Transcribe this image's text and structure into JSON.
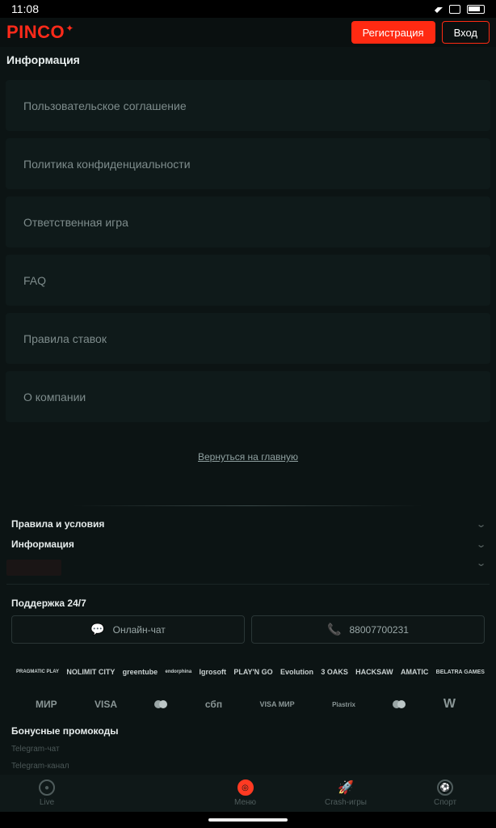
{
  "status": {
    "time": "11:08"
  },
  "header": {
    "logo": "PINCO",
    "register": "Регистрация",
    "login": "Вход"
  },
  "info": {
    "title": "Информация",
    "items": [
      "Пользовательское соглашение",
      "Политика конфиденциальности",
      "Ответственная игра",
      "FAQ",
      "Правила ставок",
      "О компании"
    ]
  },
  "back_link": "Вернуться на главную",
  "footer": {
    "accordion": [
      "Правила и условия",
      "Информация"
    ],
    "support": {
      "title": "Поддержка 24/7",
      "chat": "Онлайн-чат",
      "phone": "88007700231"
    },
    "providers": [
      "PRAGMATIC PLAY",
      "NOLIMIT CITY",
      "greentube",
      "endorphina",
      "Igrosoft",
      "PLAY'N GO",
      "Evolution",
      "3 OAKS",
      "HACKSAW",
      "AMATIC",
      "BELATRA GAMES"
    ],
    "payments": [
      "МИР",
      "VISA",
      "mastercard",
      "сбп",
      "VISA МИР",
      "Piastrix",
      "maestro",
      "W"
    ],
    "bonus_title": "Бонусные промокоды",
    "links": [
      "Telegram-чат",
      "Telegram-канал"
    ]
  },
  "nav": {
    "live": "Live",
    "menu": "Меню",
    "crash": "Crash-игры",
    "sport": "Спорт"
  }
}
